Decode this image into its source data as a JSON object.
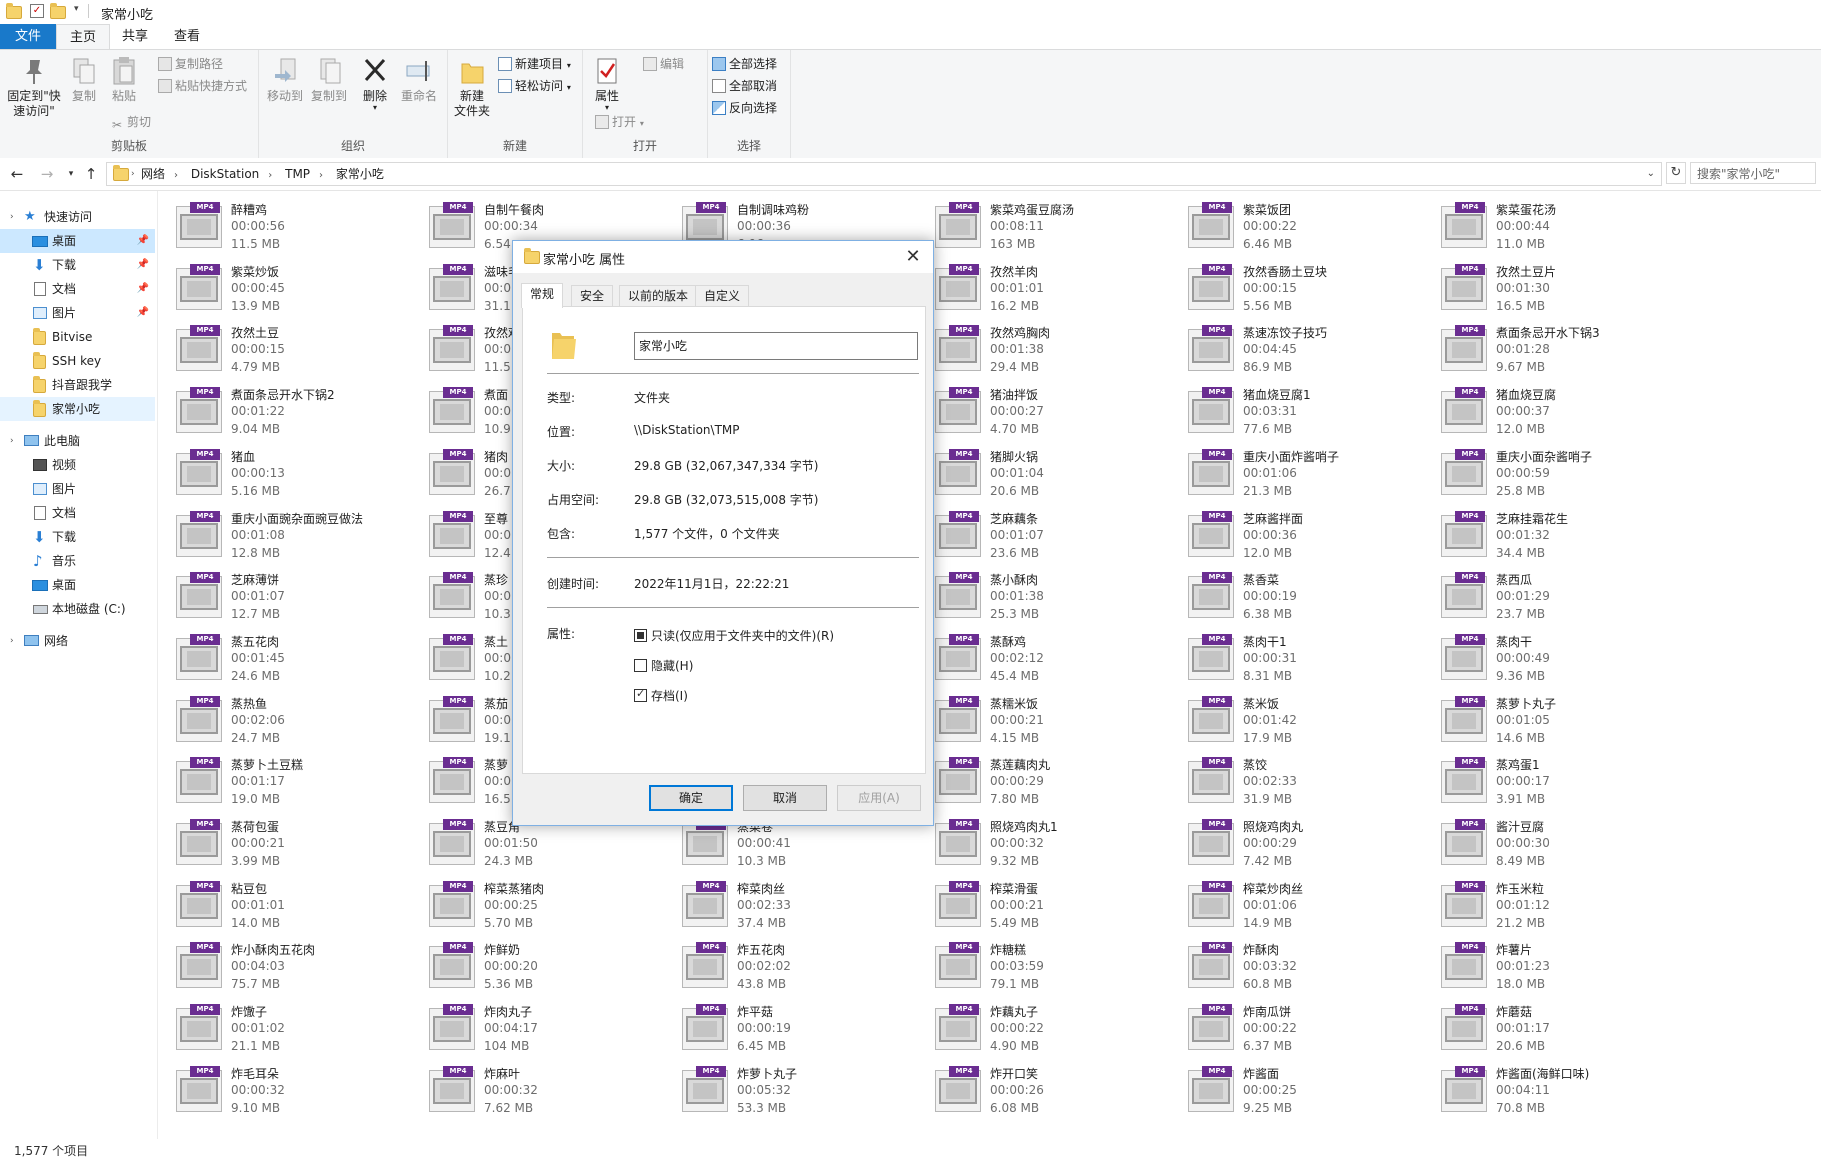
{
  "window": {
    "title": "家常小吃"
  },
  "ribbon_tabs": [
    "文件",
    "主页",
    "共享",
    "查看"
  ],
  "ribbon": {
    "clipboard": {
      "label": "剪贴板",
      "pin": "固定到\"快\n速访问\"",
      "copy": "复制",
      "paste": "粘贴",
      "copy_path": "复制路径",
      "paste_shortcut": "粘贴快捷方式",
      "cut": "剪切"
    },
    "organize": {
      "label": "组织",
      "move_to": "移动到",
      "copy_to": "复制到",
      "delete": "删除",
      "rename": "重命名"
    },
    "new": {
      "label": "新建",
      "new_folder": "新建\n文件夹",
      "new_item": "新建项目",
      "easy_access": "轻松访问"
    },
    "open": {
      "label": "打开",
      "properties": "属性",
      "open": "打开",
      "edit": "编辑"
    },
    "select": {
      "label": "选择",
      "select_all": "全部选择",
      "select_none": "全部取消",
      "invert": "反向选择"
    }
  },
  "address": {
    "crumbs": [
      "网络",
      "DiskStation",
      "TMP",
      "家常小吃"
    ],
    "search_placeholder": "搜索\"家常小吃\""
  },
  "nav": {
    "quick_access": "快速访问",
    "quick_items": [
      "桌面",
      "下载",
      "文档",
      "图片",
      "Bitvise",
      "SSH key",
      "抖音跟我学",
      "家常小吃"
    ],
    "this_pc": "此电脑",
    "pc_items": [
      "视频",
      "图片",
      "文档",
      "下载",
      "音乐",
      "桌面",
      "本地磁盘 (C:)"
    ],
    "network": "网络"
  },
  "icons": {
    "file_tag": "MP4"
  },
  "files": [
    [
      [
        "醉糟鸡",
        "00:00:56",
        "11.5 MB"
      ],
      [
        "紫菜炒饭",
        "00:00:45",
        "13.9 MB"
      ],
      [
        "孜然土豆",
        "00:00:15",
        "4.79 MB"
      ],
      [
        "煮面条忌开水下锅2",
        "00:01:22",
        "9.04 MB"
      ],
      [
        "猪血",
        "00:00:13",
        "5.16 MB"
      ],
      [
        "重庆小面豌杂面豌豆做法",
        "00:01:08",
        "12.8 MB"
      ],
      [
        "芝麻薄饼",
        "00:01:07",
        "12.7 MB"
      ],
      [
        "蒸五花肉",
        "00:01:45",
        "24.6 MB"
      ],
      [
        "蒸热鱼",
        "00:02:06",
        "24.7 MB"
      ],
      [
        "蒸萝卜土豆糕",
        "00:01:17",
        "19.0 MB"
      ],
      [
        "蒸荷包蛋",
        "00:00:21",
        "3.99 MB"
      ],
      [
        "粘豆包",
        "00:01:01",
        "14.0 MB"
      ],
      [
        "炸小酥肉五花肉",
        "00:04:03",
        "75.7 MB"
      ],
      [
        "炸馓子",
        "00:01:02",
        "21.1 MB"
      ],
      [
        "炸毛耳朵",
        "00:00:32",
        "9.10 MB"
      ]
    ],
    [
      [
        "自制午餐肉",
        "00:00:34",
        "6.54"
      ],
      [
        "滋味毛",
        "00:0",
        "31.1"
      ],
      [
        "孜然鸡",
        "00:0",
        "11.5"
      ],
      [
        "煮面",
        "00:0",
        "10.9"
      ],
      [
        "猪肉",
        "00:0",
        "26.7"
      ],
      [
        "至尊",
        "00:0",
        "12.4"
      ],
      [
        "蒸珍",
        "00:0",
        "10.3"
      ],
      [
        "蒸土",
        "00:0",
        "10.2"
      ],
      [
        "蒸茄",
        "00:0",
        "19.1"
      ],
      [
        "蒸萝",
        "00:0",
        "16.5"
      ],
      [
        "蒸豆角",
        "00:01:50",
        "24.3 MB"
      ],
      [
        "榨菜蒸猪肉",
        "00:00:25",
        "5.70 MB"
      ],
      [
        "炸鲜奶",
        "00:00:20",
        "5.36 MB"
      ],
      [
        "炸肉丸子",
        "00:04:17",
        "104 MB"
      ],
      [
        "炸麻叶",
        "00:00:32",
        "7.62 MB"
      ]
    ],
    [
      [
        "自制调味鸡粉",
        "00:00:36",
        "6.06"
      ],
      [
        "",
        "",
        ""
      ],
      [
        "",
        "",
        ""
      ],
      [
        "",
        "",
        ""
      ],
      [
        "",
        "",
        ""
      ],
      [
        "",
        "",
        ""
      ],
      [
        "",
        "",
        ""
      ],
      [
        "",
        "",
        ""
      ],
      [
        "",
        "",
        ""
      ],
      [
        "",
        "",
        ""
      ],
      [
        "蒸菜卷",
        "00:00:41",
        "10.3 MB"
      ],
      [
        "榨菜肉丝",
        "00:02:33",
        "37.4 MB"
      ],
      [
        "炸五花肉",
        "00:02:02",
        "43.8 MB"
      ],
      [
        "炸平菇",
        "00:00:19",
        "6.45 MB"
      ],
      [
        "炸萝卜丸子",
        "00:05:32",
        "53.3 MB"
      ]
    ],
    [
      [
        "紫菜鸡蛋豆腐汤",
        "00:08:11",
        "163 MB"
      ],
      [
        "孜然羊肉",
        "00:01:01",
        "16.2 MB"
      ],
      [
        "孜然鸡胸肉",
        "00:01:38",
        "29.4 MB"
      ],
      [
        "猪油拌饭",
        "00:00:27",
        "4.70 MB"
      ],
      [
        "猪脚火锅",
        "00:01:04",
        "20.6 MB"
      ],
      [
        "芝麻藕条",
        "00:01:07",
        "23.6 MB"
      ],
      [
        "蒸小酥肉",
        "00:01:38",
        "25.3 MB"
      ],
      [
        "蒸酥鸡",
        "00:02:12",
        "45.4 MB"
      ],
      [
        "蒸糯米饭",
        "00:00:21",
        "4.15 MB"
      ],
      [
        "蒸莲藕肉丸",
        "00:00:29",
        "7.80 MB"
      ],
      [
        "照烧鸡肉丸1",
        "00:00:32",
        "9.32 MB"
      ],
      [
        "榨菜滑蛋",
        "00:00:21",
        "5.49 MB"
      ],
      [
        "炸糖糕",
        "00:03:59",
        "79.1 MB"
      ],
      [
        "炸藕丸子",
        "00:00:22",
        "4.90 MB"
      ],
      [
        "炸开口笑",
        "00:00:26",
        "6.08 MB"
      ]
    ],
    [
      [
        "紫菜饭团",
        "00:00:22",
        "6.46 MB"
      ],
      [
        "孜然香肠土豆块",
        "00:00:15",
        "5.56 MB"
      ],
      [
        "蒸速冻饺子技巧",
        "00:04:45",
        "86.9 MB"
      ],
      [
        "猪血烧豆腐1",
        "00:03:31",
        "77.6 MB"
      ],
      [
        "重庆小面炸酱哨子",
        "00:01:06",
        "21.3 MB"
      ],
      [
        "芝麻酱拌面",
        "00:00:36",
        "12.0 MB"
      ],
      [
        "蒸香菜",
        "00:00:19",
        "6.38 MB"
      ],
      [
        "蒸肉干1",
        "00:00:31",
        "8.31 MB"
      ],
      [
        "蒸米饭",
        "00:01:42",
        "17.9 MB"
      ],
      [
        "蒸饺",
        "00:02:33",
        "31.9 MB"
      ],
      [
        "照烧鸡肉丸",
        "00:00:29",
        "7.42 MB"
      ],
      [
        "榨菜炒肉丝",
        "00:01:06",
        "14.9 MB"
      ],
      [
        "炸酥肉",
        "00:03:32",
        "60.8 MB"
      ],
      [
        "炸南瓜饼",
        "00:00:22",
        "6.37 MB"
      ],
      [
        "炸酱面",
        "00:00:25",
        "9.25 MB"
      ]
    ],
    [
      [
        "紫菜蛋花汤",
        "00:00:44",
        "11.0 MB"
      ],
      [
        "孜然土豆片",
        "00:01:30",
        "16.5 MB"
      ],
      [
        "煮面条忌开水下锅3",
        "00:01:28",
        "9.67 MB"
      ],
      [
        "猪血烧豆腐",
        "00:00:37",
        "12.0 MB"
      ],
      [
        "重庆小面杂酱哨子",
        "00:00:59",
        "25.8 MB"
      ],
      [
        "芝麻挂霜花生",
        "00:01:32",
        "34.4 MB"
      ],
      [
        "蒸西瓜",
        "00:01:29",
        "23.7 MB"
      ],
      [
        "蒸肉干",
        "00:00:49",
        "9.36 MB"
      ],
      [
        "蒸萝卜丸子",
        "00:01:05",
        "14.6 MB"
      ],
      [
        "蒸鸡蛋1",
        "00:00:17",
        "3.91 MB"
      ],
      [
        "酱汁豆腐",
        "00:00:30",
        "8.49 MB"
      ],
      [
        "炸玉米粒",
        "00:01:12",
        "21.2 MB"
      ],
      [
        "炸薯片",
        "00:01:23",
        "18.0 MB"
      ],
      [
        "炸蘑菇",
        "00:01:17",
        "20.6 MB"
      ],
      [
        "炸酱面(海鲜口味)",
        "00:04:11",
        "70.8 MB"
      ]
    ]
  ],
  "status": {
    "count": "1,577 个项目"
  },
  "dialog": {
    "title": "家常小吃 属性",
    "close": "✕",
    "tabs": [
      "常规",
      "安全",
      "以前的版本",
      "自定义"
    ],
    "name": "家常小吃",
    "rows": [
      {
        "label": "类型:",
        "value": "文件夹"
      },
      {
        "label": "位置:",
        "value": "\\\\DiskStation\\TMP"
      },
      {
        "label": "大小:",
        "value": "29.8 GB (32,067,347,334 字节)"
      },
      {
        "label": "占用空间:",
        "value": "29.8 GB (32,073,515,008 字节)"
      },
      {
        "label": "包含:",
        "value": "1,577 个文件，0 个文件夹"
      }
    ],
    "created_label": "创建时间:",
    "created_value": "2022年11月1日，22:22:21",
    "attr_label": "属性:",
    "readonly": "只读(仅应用于文件夹中的文件)(R)",
    "hidden": "隐藏(H)",
    "archive": "存档(I)",
    "ok": "确定",
    "cancel": "取消",
    "apply": "应用(A)"
  }
}
